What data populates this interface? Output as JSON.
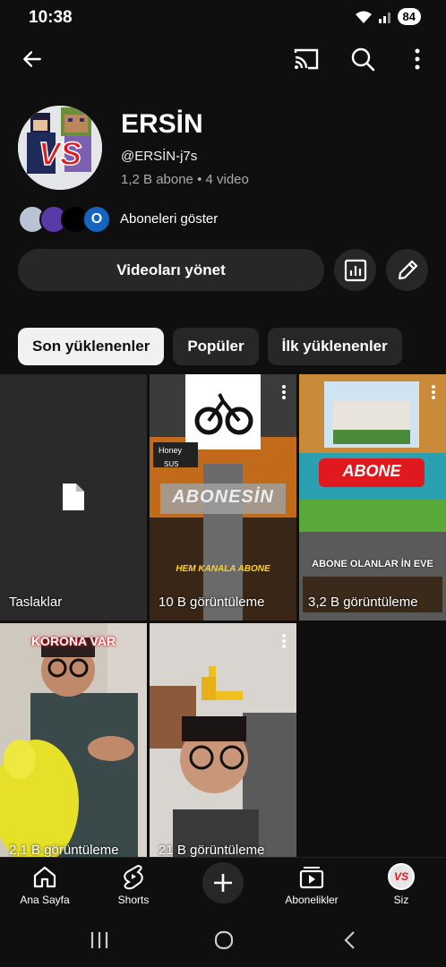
{
  "status": {
    "time": "10:38",
    "battery": "84"
  },
  "channel": {
    "title": "ERSİN",
    "handle": "@ERSİN-j7s",
    "meta": "1,2 B abone • 4 video",
    "avatar_text": "VS"
  },
  "subscribers": {
    "label": "Aboneleri göster",
    "badge_letter": "O"
  },
  "actions": {
    "manage_label": "Videoları yönet"
  },
  "chips": [
    {
      "label": "Son yüklenenler",
      "active": true
    },
    {
      "label": "Popüler",
      "active": false
    },
    {
      "label": "İlk yüklenenler",
      "active": false
    }
  ],
  "tiles": [
    {
      "label": "Taslaklar"
    },
    {
      "label": "10 B görüntüleme",
      "thumb_text_1": "ABONESİN",
      "thumb_text_2": "HEM KANALA ABONE",
      "thumb_text_3": "Honey",
      "thumb_text_4": "SUS"
    },
    {
      "label": "3,2 B görüntüleme",
      "thumb_text_1": "ABONE",
      "thumb_text_2": "ABONE OLANLAR İN EVE"
    },
    {
      "label": "2,1 B görüntüleme",
      "thumb_text_1": "KORONA VAR"
    },
    {
      "label": "21 B görüntüleme"
    }
  ],
  "nav": [
    {
      "label": "Ana Sayfa",
      "icon": "home-icon"
    },
    {
      "label": "Shorts",
      "icon": "shorts-icon"
    },
    {
      "label": "",
      "icon": "create-icon"
    },
    {
      "label": "Abonelikler",
      "icon": "subscriptions-icon"
    },
    {
      "label": "Siz",
      "icon": "avatar"
    }
  ],
  "colors": {
    "background": "#0f0f0f",
    "chip": "#272727",
    "accent_red": "#e0191e"
  }
}
